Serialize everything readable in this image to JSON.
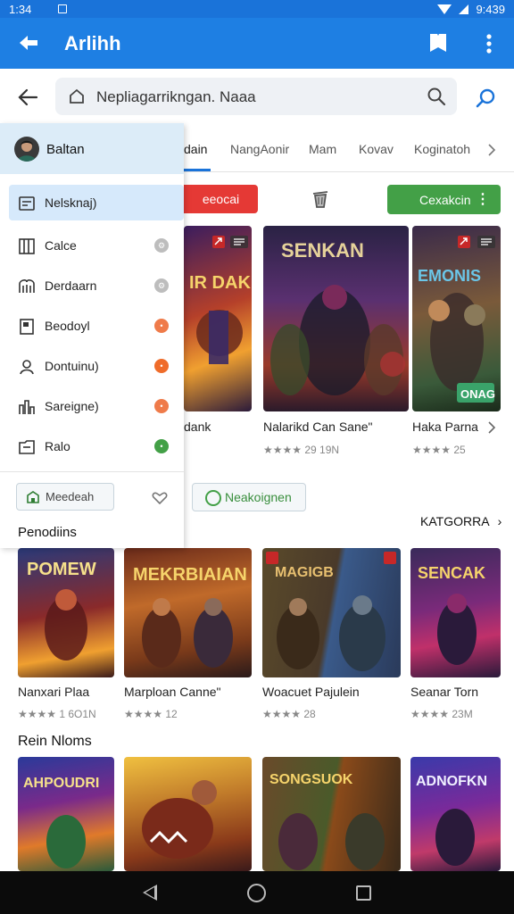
{
  "status": {
    "time": "1:34",
    "battery": "9:439"
  },
  "appbar": {
    "title": "Arlihh"
  },
  "search": {
    "query": "Nepliagarrikngan. Naaa"
  },
  "tabs": [
    {
      "label": "dain"
    },
    {
      "label": "NangAonir"
    },
    {
      "label": "Mam"
    },
    {
      "label": "Kovav"
    },
    {
      "label": "Koginatoh"
    }
  ],
  "actions": {
    "red_label": "eeocai",
    "green_label": "Cexakcin",
    "outline_label": "Neakoignen"
  },
  "featured": [
    {
      "title": "dank",
      "rating": "",
      "img_text": "IR DAK",
      "badge": ""
    },
    {
      "title": "Nalarikd Can Sane\"",
      "rating": "★★★★ 29 19N",
      "img_text": "SENKAN",
      "badge": ""
    },
    {
      "title": "Haka Parna",
      "rating": "★★★★ 25",
      "img_text": "EMONIS",
      "badge": "ONAG"
    }
  ],
  "drawer": {
    "username": "Baltan",
    "items": [
      {
        "label": "Nelsknaj)",
        "badge": ""
      },
      {
        "label": "Calce",
        "badge": ""
      },
      {
        "label": "Derdaarn",
        "badge": ""
      },
      {
        "label": "Beodoyl",
        "badge": ""
      },
      {
        "label": "Dontuinu)",
        "badge": ""
      },
      {
        "label": "Sareigne)",
        "badge": ""
      },
      {
        "label": "Ralo",
        "badge": ""
      }
    ],
    "button_label": "Meedeah",
    "section_label": "Penodiins"
  },
  "colors": {
    "primary": "#1e7fe3",
    "red": "#e53935",
    "green": "#43a047"
  },
  "category_link": "KATGORRA",
  "popular": [
    {
      "title": "Nanxari Plaa",
      "rating": "★★★★ 1 6O1N",
      "img_text": "POMEW"
    },
    {
      "title": "Marploan Canne\"",
      "rating": "★★★★ 12",
      "img_text": "MEKRBIAIAN"
    },
    {
      "title": "Woacuet Pajulein",
      "rating": "★★★★ 28",
      "img_text": "MAGIGB"
    },
    {
      "title": "Seanar Torn",
      "rating": "★★★★ 23M",
      "img_text": "SENCAK"
    }
  ],
  "section2": "Rein Nloms",
  "bottom": [
    {
      "img_text": "AHPOUDRI"
    },
    {
      "img_text": ""
    },
    {
      "img_text": "SONGSUOK"
    },
    {
      "img_text": "ADNOFKN"
    }
  ]
}
